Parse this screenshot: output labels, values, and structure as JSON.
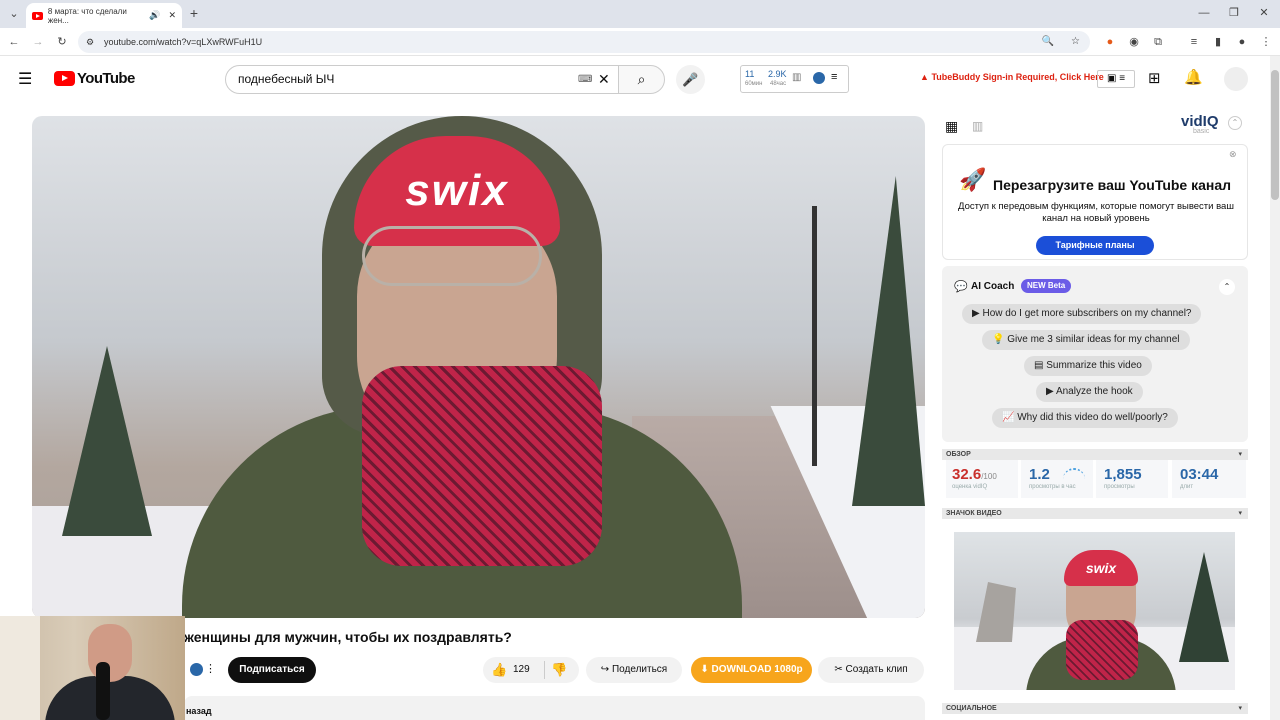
{
  "browser": {
    "tab_title": "8 марта: что сделали жен...",
    "new_tab": "+",
    "url": "youtube.com/watch?v=qLXwRWFuH1U",
    "win_minimize": "—",
    "win_restore": "❐",
    "win_close": "✕"
  },
  "youtube": {
    "logo_text": "YouTube",
    "search_value": "поднебесный ЫЧ",
    "vidiq_views_top": "11",
    "vidiq_views_label": "60мин",
    "vidiq_subs_top": "2.9K",
    "vidiq_subs_label": "48час",
    "tubebuddy_notice": "TubeBuddy Sign-in Required, Click Here"
  },
  "video": {
    "hat_text": "swix",
    "title": "женщины для мужчин, чтобы их поздравлять?",
    "subscribe_label": "Подписаться",
    "like_count": "129",
    "share_label": "Поделиться",
    "download_label": "DOWNLOAD 1080p",
    "clip_label": "Создать клип",
    "description_partial": "назад"
  },
  "vidiq": {
    "brand": "vidIQ",
    "plan": "basic",
    "promo_title": "Перезагрузите ваш YouTube канал",
    "promo_text": "Доступ к передовым функциям, которые помогут вывести ваш канал на новый уровень",
    "promo_button": "Тарифные планы",
    "ai_title": "AI Coach",
    "ai_badge": "NEW Beta",
    "ai_prompts": [
      "How do I get more subscribers on my channel?",
      "Give me 3 similar ideas for my channel",
      "Summarize this video",
      "Analyze the hook",
      "Why did this video do well/poorly?"
    ],
    "overview_header": "ОБЗОР",
    "score": "32.6",
    "score_max": "/100",
    "score_label": "оценка vidIQ",
    "views_per_hour": "1.2",
    "views_per_hour_label": "просмотры в час",
    "views": "1,855",
    "views_label": "просмотры",
    "duration": "03:44",
    "duration_label": "длит",
    "thumbnail_header": "ЗНАЧОК ВИДЕО",
    "social_header": "СОЦИАЛЬНОЕ"
  }
}
